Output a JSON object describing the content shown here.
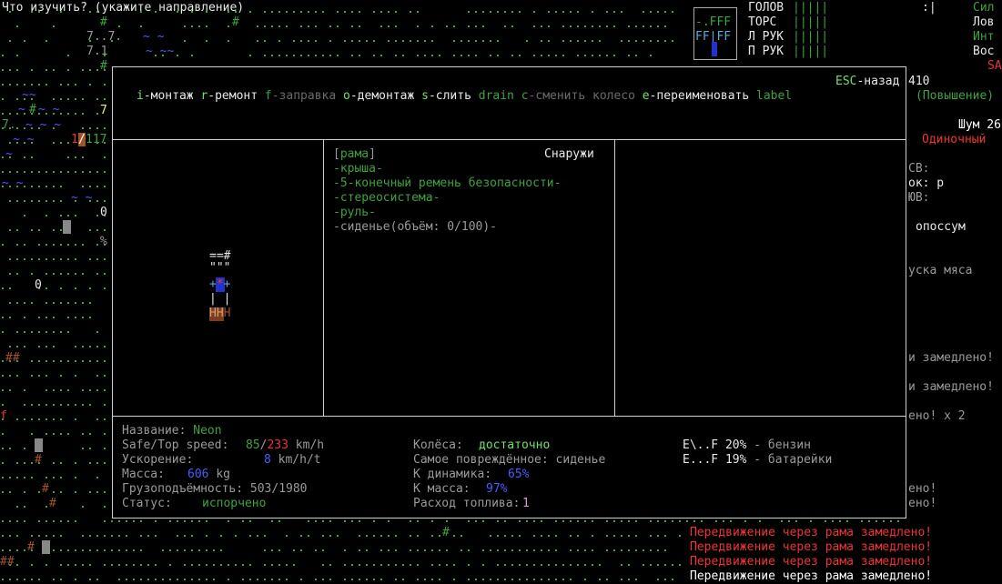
{
  "header": {
    "prompt": "Что изучить? (укажите направление)",
    "stats_labels": [
      "Сил",
      "Лов",
      "Инт",
      "Вос"
    ],
    "sa": "SA",
    "body_parts": [
      {
        "label": "ГОЛОВ",
        "bar": "|||||"
      },
      {
        "label": "ТОРС",
        "bar": "|||||"
      },
      {
        "label": "Л РУК",
        "bar": "|||||"
      },
      {
        "label": "П РУК",
        "bar": "|||||"
      }
    ],
    "time_marker": ":|",
    "minimap": {
      "l1": "-.FFF",
      "l2": "FF|FF"
    }
  },
  "sidebar_right": {
    "num": "410",
    "povyshenie": "(Повышение)",
    "noise": "Шум 26",
    "single": "Одиночный",
    "sv": "СВ:",
    "ok": "ок: р",
    "yv": "ЮВ:",
    "creature": "опоссум",
    "meat": "уска мяса"
  },
  "left_map": {
    "n7": "7",
    "hp_cur": "1",
    "hp_sep": "/",
    "hp_max": "117",
    "zero1": "0",
    "zero2": "0",
    "pct": "%",
    "f": "f"
  },
  "veh": {
    "hotkeys": [
      {
        "key": "i",
        "label": "-монтаж",
        "dim": false
      },
      {
        "key": "r",
        "label": "-ремонт",
        "dim": false
      },
      {
        "key": "f",
        "label": "-заправка",
        "dim": true
      },
      {
        "key": "o",
        "label": "-демонтаж",
        "dim": false
      },
      {
        "key": "s",
        "label": "-слить",
        "dim": false
      },
      {
        "key": "drain",
        "label": "",
        "dim": true
      },
      {
        "key": "c",
        "label": "-сменить колесо",
        "dim": true
      },
      {
        "key": "e",
        "label": "-переименовать",
        "dim": false
      },
      {
        "key": "label",
        "label": "",
        "dim": true
      }
    ],
    "esc_key": "ESC",
    "esc_label": "-назад",
    "sprite": {
      "l1": "==#",
      "l2": "\"\"\"",
      "l3": "+",
      "l3b": "*",
      "l3c": "+",
      "l4": "| |",
      "l5": "HH",
      "l5b": "H"
    },
    "parts_header": "рама",
    "location": "Снаружи",
    "parts": [
      "-крыша-",
      "-5-конечный ремень безопасности-",
      "-стереосистема-",
      "-руль-"
    ],
    "selected_part": "-сиденье(объём: 0/100)-",
    "info": {
      "name_label": "Название:",
      "name": "Neon",
      "speed_label": "Safe/Top speed:",
      "safe_speed": "85",
      "speed_sep": "/",
      "top_speed": "233",
      "speed_unit": "km/h",
      "accel_label": "Ускорение:",
      "accel": "8",
      "accel_unit": "km/h/t",
      "mass_label": "Масса:",
      "mass": "606",
      "mass_unit": "kg",
      "cargo_label": "Грузоподъёмность:",
      "cargo": "503/1980",
      "status_label": "Статус:",
      "status": "испорчено",
      "wheels_label": "Колёса:",
      "wheels": "достаточно",
      "damaged_label": "Самое повреждённое:",
      "damaged": "сиденье",
      "kdyn_label": "К динамика:",
      "kdyn": "65%",
      "kmass_label": "К масса:",
      "kmass": "97%",
      "fuel_use_label": "Расход топлива:",
      "fuel_use": "1",
      "fuel1_gauge": "E\\..F",
      "fuel1_pct": "20%",
      "fuel1_name": "- бензин",
      "fuel2_gauge": "E...F",
      "fuel2_pct": "19%",
      "fuel2_name": "- батарейки"
    }
  },
  "log": {
    "right_lines": [
      "и замедлено!",
      "и замедлено!",
      "ено! x 2",
      "ено!",
      "ено!"
    ],
    "bottom_lines": [
      "Передвижение через рама замедлено!",
      "Передвижение через рама замедлено!",
      "Передвижение через рама замедлено!",
      "Передвижение через рама замедлено!"
    ]
  },
  "colors": {
    "green": "#3da33d",
    "light_green": "#6fe06f",
    "blue": "#4a5cff",
    "red": "#e33",
    "brown": "#a0522d",
    "border": "#cfcfcf"
  }
}
